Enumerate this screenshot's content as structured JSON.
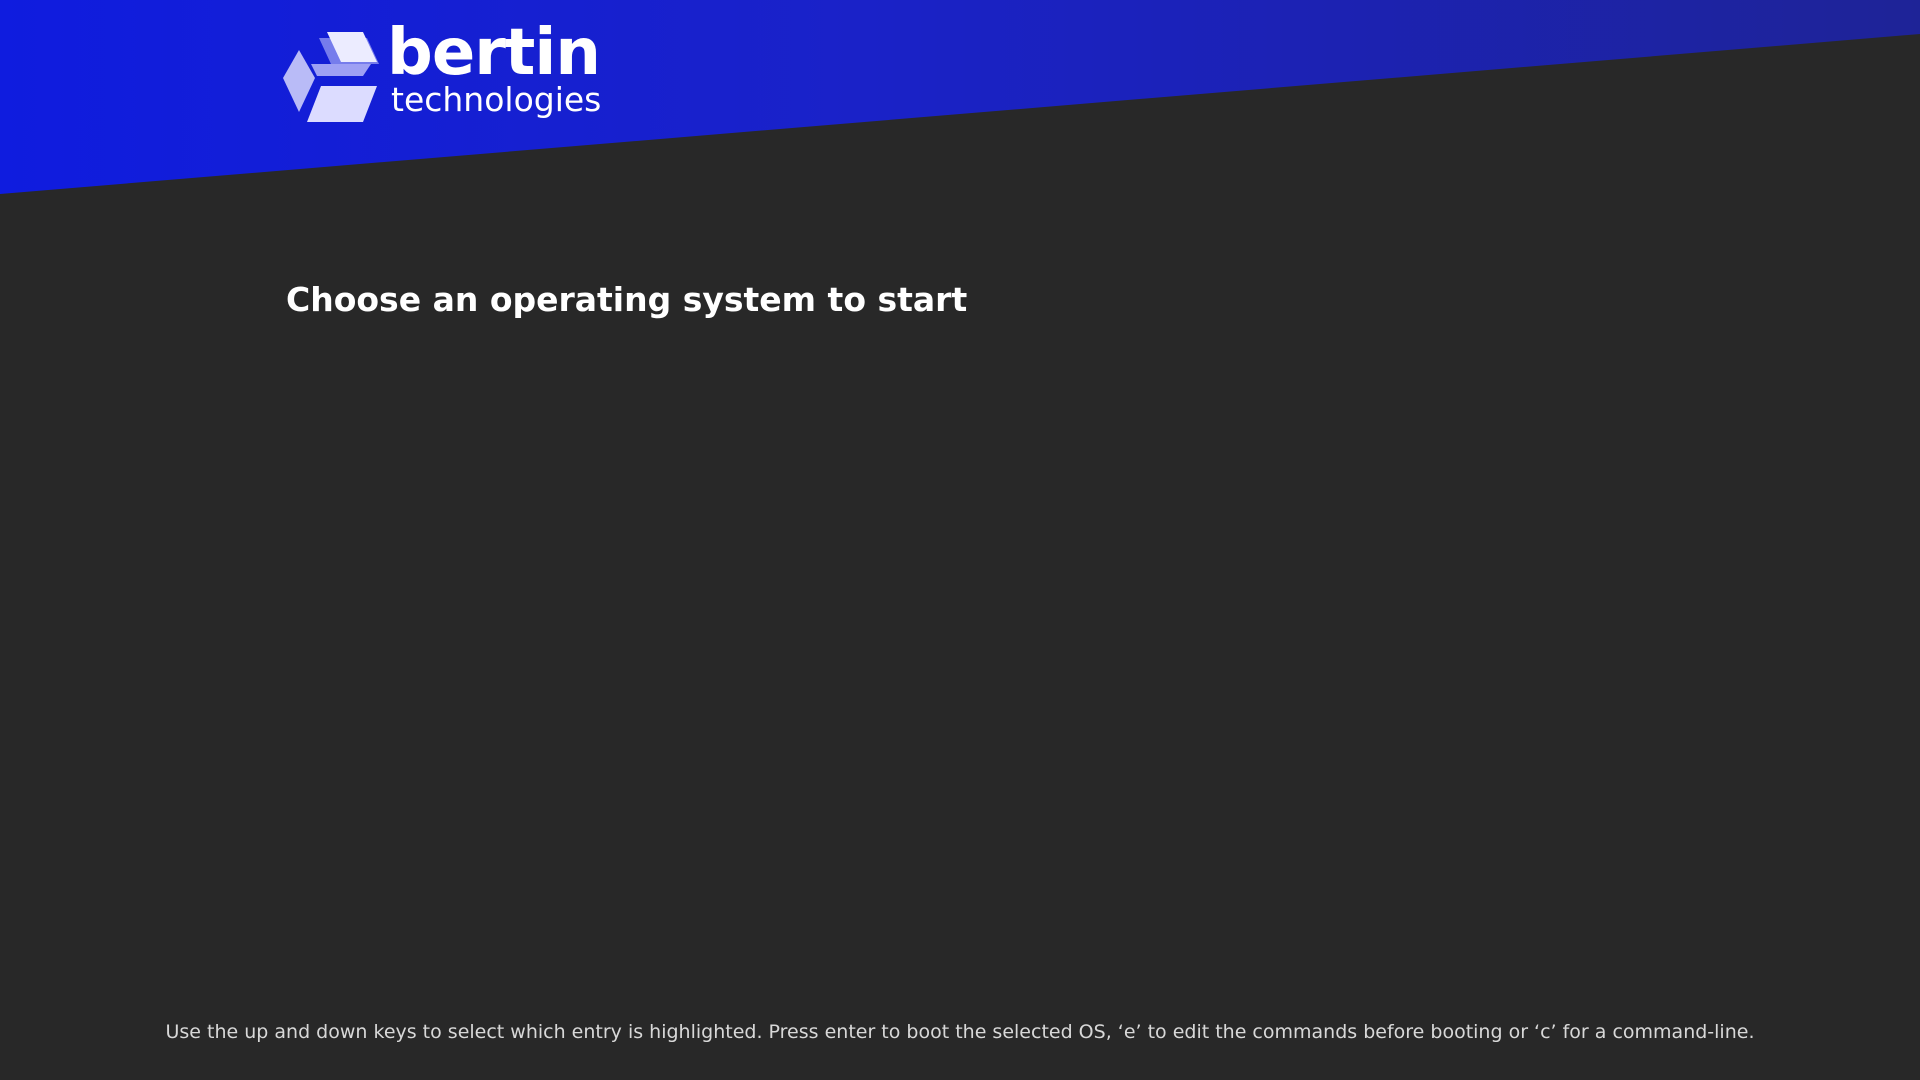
{
  "brand": {
    "name": "bertin",
    "tagline": "technologies",
    "logo_icon": "cube-icon"
  },
  "menu": {
    "title": "Choose an operating system to start",
    "entries": []
  },
  "footer": {
    "help": "Use the up and down keys to select which entry is highlighted. Press enter to boot the selected OS, ‘e’ to edit the commands before booting or ‘c’ for a command-line."
  },
  "colors": {
    "background": "#282828",
    "header_blue_start": "#0f1cdf",
    "header_blue_end": "#1e2397",
    "text": "#ffffff",
    "help_text": "#d8d8d8"
  }
}
